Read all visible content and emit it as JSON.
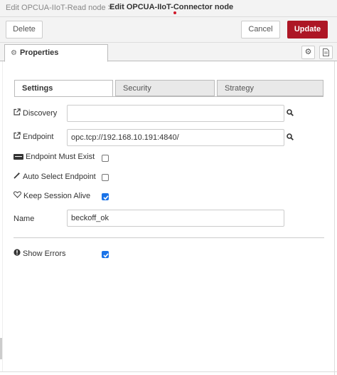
{
  "header": {
    "breadcrumb_prev": "Edit OPCUA-IIoT-Read node >",
    "breadcrumb_current": "Edit OPCUA-IIoT-Connector node",
    "accent_color": "#ad1625"
  },
  "toolbar": {
    "delete_label": "Delete",
    "cancel_label": "Cancel",
    "update_label": "Update"
  },
  "tabs": {
    "properties_label": "Properties",
    "properties_icon": "gear-icon",
    "settings_icon": "gear-icon",
    "description_icon": "document-icon"
  },
  "subtabs": {
    "settings": "Settings",
    "security": "Security",
    "strategy": "Strategy"
  },
  "form": {
    "discovery": {
      "label": "Discovery",
      "value": "",
      "icon": "external-link-icon"
    },
    "endpoint": {
      "label": "Endpoint",
      "value": "opc.tcp://192.168.10.191:4840/",
      "icon": "external-link-icon"
    },
    "endpoint_must_exist": {
      "label": "Endpoint Must Exist",
      "checked": false,
      "icon": "plug-icon"
    },
    "auto_select_endpoint": {
      "label": "Auto Select Endpoint",
      "checked": false,
      "icon": "magic-wand-icon"
    },
    "keep_session_alive": {
      "label": "Keep Session Alive",
      "checked": true,
      "icon": "heart-icon"
    },
    "name": {
      "label": "Name",
      "value": "beckoff_ok"
    },
    "show_errors": {
      "label": "Show Errors",
      "checked": true,
      "icon": "exclamation-icon"
    }
  }
}
